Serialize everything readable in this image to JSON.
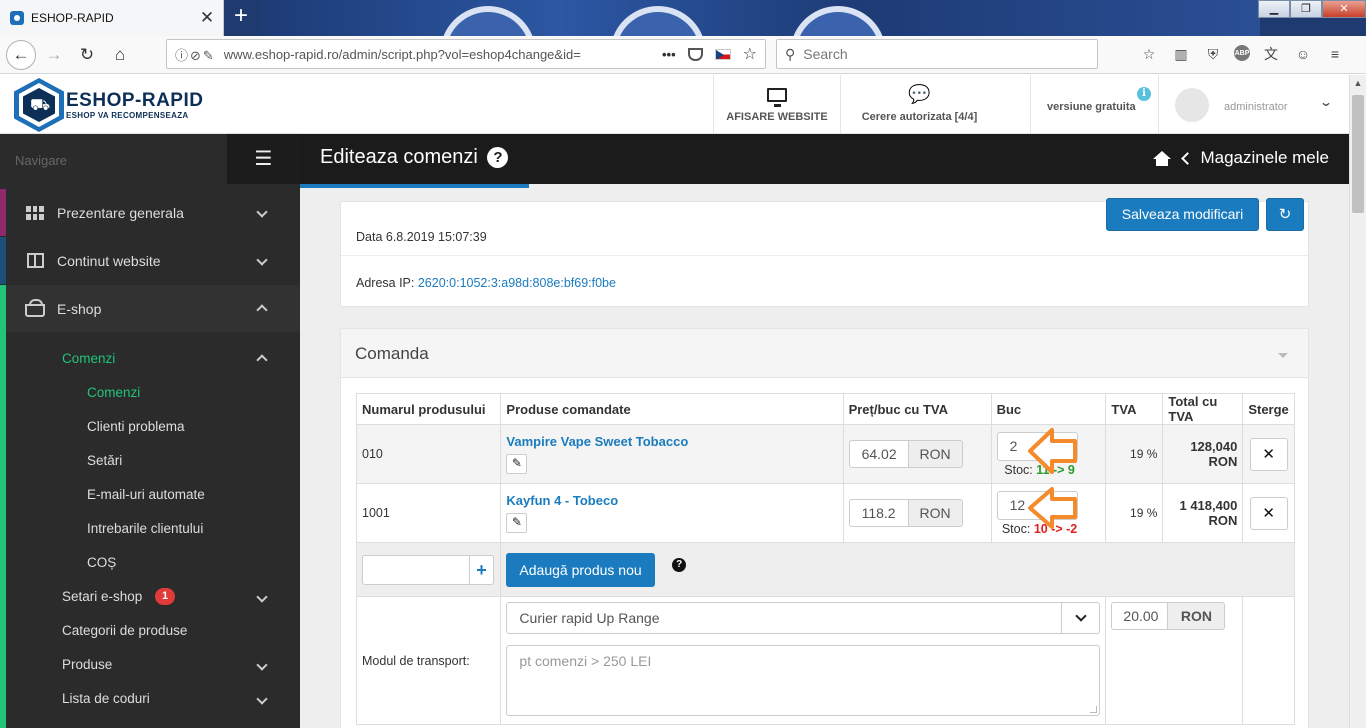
{
  "browser": {
    "tab_title": "ESHOP-RAPID",
    "url": "www.eshop-rapid.ro/admin/script.php?vol=eshop4change&id=",
    "search_placeholder": "Search",
    "tool_badges": [
      "ABP"
    ]
  },
  "header": {
    "brand": "ESHOP-RAPID",
    "tagline": "ESHOP VA RECOMPENSEAZA",
    "view_website": "AFISARE WEBSITE",
    "requests": "Cerere autorizata [4/4]",
    "version": "versiune gratuita",
    "user": "administrator"
  },
  "sidebar": {
    "nav_label": "Navigare",
    "items": [
      {
        "label": "Prezentare generala",
        "accent": "#8e2a6b"
      },
      {
        "label": "Continut website",
        "accent": "#1c4f7a"
      },
      {
        "label": "E-shop",
        "accent": "#22c47a"
      }
    ],
    "eshop_sub": [
      {
        "label": "Comenzi",
        "active": true
      },
      {
        "label": "Comenzi",
        "active": true
      },
      {
        "label": "Clienti problema"
      },
      {
        "label": "Setări"
      },
      {
        "label": "E-mail-uri automate"
      },
      {
        "label": "Intrebarile clientului"
      },
      {
        "label": "COȘ"
      },
      {
        "label": "Setari e-shop",
        "badge": "1"
      },
      {
        "label": "Categorii de produse"
      },
      {
        "label": "Produse"
      },
      {
        "label": "Lista de coduri"
      }
    ]
  },
  "page": {
    "title": "Editeaza comenzi",
    "home_link": "Magazinele mele",
    "save_button": "Salveaza modificari",
    "date_line": "Data 6.8.2019 15:07:39",
    "ip_label": "Adresa IP:",
    "ip_value": "2620:0:1052:3:a98d:808e:bf69:f0be"
  },
  "order": {
    "section_title": "Comanda",
    "columns": [
      "Numarul produsului",
      "Produse comandate",
      "Preț/buc cu TVA",
      "Buc",
      "TVA",
      "Total cu TVA",
      "Sterge"
    ],
    "currency": "RON",
    "stock_label": "Stoc:",
    "rows": [
      {
        "code": "010",
        "name": "Vampire Vape Sweet Tobacco",
        "price": "64.02",
        "qty": "2",
        "stock": "11 -> 9",
        "stock_ok": true,
        "vat": "19 %",
        "total": "128,040 RON"
      },
      {
        "code": "1001",
        "name": "Kayfun 4 - Tobeco",
        "price": "118.2",
        "qty": "12",
        "stock": "10 -> -2",
        "stock_ok": false,
        "vat": "19 %",
        "total": "1 418,400 RON"
      }
    ],
    "add_product_button": "Adaugă produs nou",
    "transport_label": "Modul de transport:",
    "transport_value": "Curier rapid Up Range",
    "transport_note_placeholder": "pt comenzi > 250 LEI",
    "shipping_price": "20.00"
  },
  "colors": {
    "accent_blue": "#1a7bbf",
    "sidebar_bg": "#2b2b2b",
    "active_green": "#22c47a",
    "arrow_orange": "#f58a2b"
  }
}
